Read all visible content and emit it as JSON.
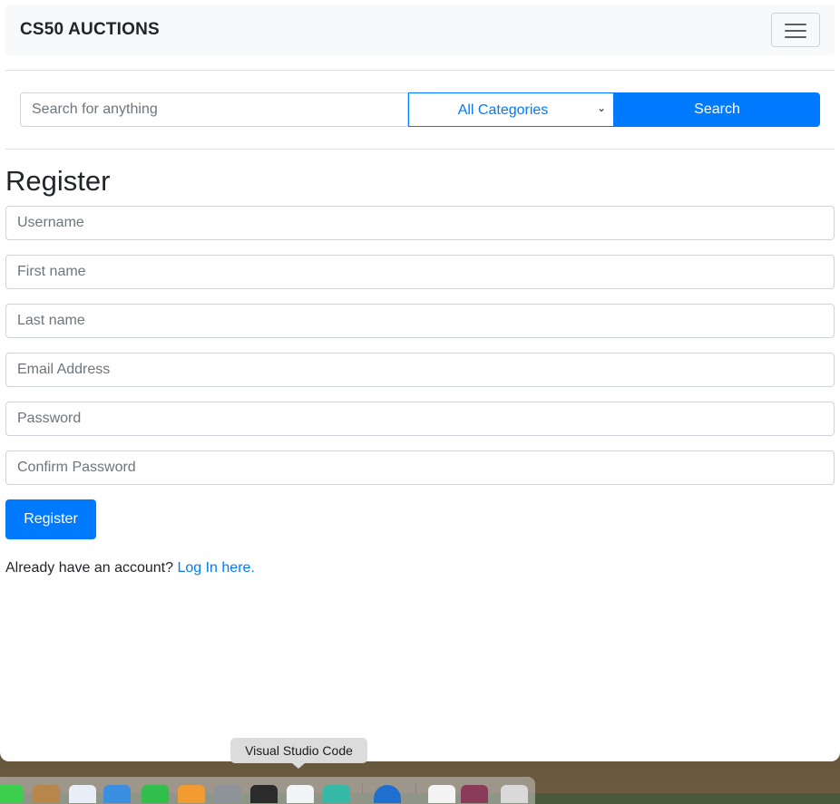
{
  "navbar": {
    "brand": "CS50 AUCTIONS",
    "toggler_icon": "hamburger-menu-icon"
  },
  "search": {
    "placeholder": "Search for anything",
    "category_selected": "All Categories",
    "button_label": "Search"
  },
  "form": {
    "title": "Register",
    "fields": {
      "username": "Username",
      "first_name": "First name",
      "last_name": "Last name",
      "email": "Email Address",
      "password": "Password",
      "confirm_password": "Confirm Password"
    },
    "submit_label": "Register",
    "login_prompt": "Already have an account?",
    "login_link": "Log In here."
  },
  "dock": {
    "tooltip": "Visual Studio Code",
    "icons": [
      "facetime-icon",
      "finder-icon",
      "notes-icon",
      "xcode-icon",
      "numbers-icon",
      "pages-icon",
      "system-preferences-icon",
      "terminal-icon",
      "visual-studio-code-icon",
      "app-icon",
      "chrome-icon",
      "document-icon",
      "photo-icon",
      "trash-icon"
    ]
  },
  "colors": {
    "primary": "#007bff",
    "navbar_bg": "#f8f9fa",
    "text": "#212529"
  }
}
